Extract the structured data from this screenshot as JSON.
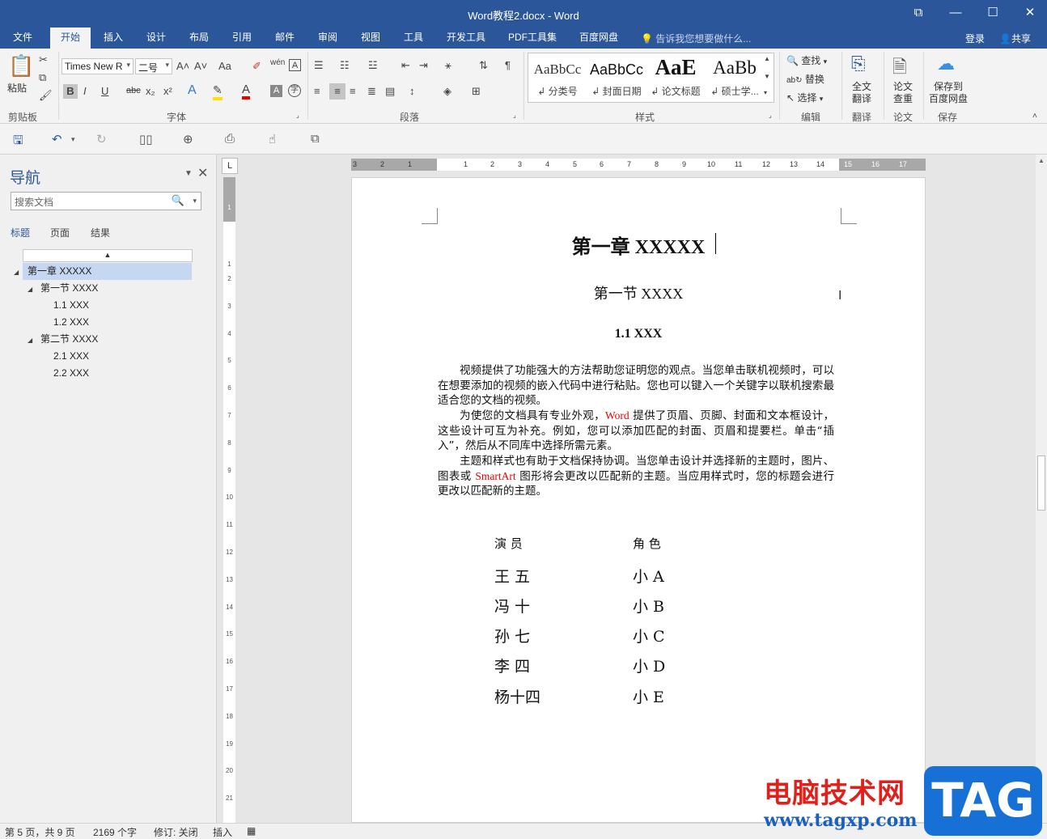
{
  "window": {
    "title": "Word教程2.docx - Word",
    "buttons": [
      "⧉",
      "—",
      "☐",
      "✕"
    ]
  },
  "tabs": [
    "文件",
    "开始",
    "插入",
    "设计",
    "布局",
    "引用",
    "邮件",
    "审阅",
    "视图",
    "工具",
    "开发工具",
    "PDF工具集",
    "百度网盘"
  ],
  "tell_me": "告诉我您想要做什么...",
  "login": "登录",
  "share": "共享",
  "ribbon": {
    "clipboard": {
      "paste": "粘贴",
      "label": "剪贴板"
    },
    "font": {
      "name": "Times New R",
      "size": "二号",
      "label": "字体",
      "aa": "Aa",
      "bold": "B",
      "italic": "I",
      "underline": "U",
      "strike": "abc",
      "sub": "x₂",
      "sup": "x²",
      "color_a": "A"
    },
    "paragraph": {
      "label": "段落"
    },
    "styles": {
      "label": "样式",
      "items": [
        {
          "sample": "AaBbCc",
          "name": "↲ 分类号"
        },
        {
          "sample": "AaBbCc",
          "name": "↲ 封面日期"
        },
        {
          "sample": "AaE",
          "name": "↲ 论文标题"
        },
        {
          "sample": "AaBb",
          "name": "↲ 硕士学..."
        }
      ]
    },
    "editing": {
      "find": "查找",
      "replace": "替换",
      "select": "选择",
      "label": "编辑"
    },
    "translate": {
      "btn1": "全文",
      "btn2": "翻译",
      "label": "翻译"
    },
    "thesis": {
      "btn1": "论文",
      "btn2": "查重",
      "label": "论文"
    },
    "save": {
      "btn1": "保存到",
      "btn2": "百度网盘",
      "label": "保存"
    }
  },
  "nav": {
    "title": "导航",
    "search_placeholder": "搜索文档",
    "tabs": [
      "标题",
      "页面",
      "结果"
    ],
    "collapse_glyph": "▲",
    "headings": [
      "第一章 XXXXX",
      "第一节 XXXX",
      "1.1 XXX",
      "1.2 XXX",
      "第二节 XXXX",
      "2.1 XXX",
      "2.2 XXX"
    ]
  },
  "ruler": {
    "h_labels": [
      "3",
      "2",
      "1",
      "1",
      "2",
      "3",
      "4",
      "5",
      "6",
      "7",
      "8",
      "9",
      "10",
      "11",
      "12",
      "13",
      "14",
      "15",
      "16",
      "17"
    ],
    "v_labels": [
      "1",
      "1",
      "2",
      "3",
      "4",
      "5",
      "6",
      "7",
      "8",
      "9",
      "10",
      "11",
      "12",
      "13",
      "14",
      "15",
      "16",
      "17",
      "18",
      "19",
      "20",
      "21"
    ],
    "corner": "L"
  },
  "document": {
    "h1": "第一章  XXXXX",
    "h2": "第一节  XXXX",
    "h3": "1.1 XXX",
    "p1": "视频提供了功能强大的方法帮助您证明您的观点。当您单击联机视频时，可以在想要添加的视频的嵌入代码中进行粘贴。您也可以键入一个关键字以联机搜索最适合您的文档的视频。",
    "p2a": "为使您的文档具有专业外观，",
    "p2_word": "Word",
    "p2b": " 提供了页眉、页脚、封面和文本框设计，这些设计可互为补充。例如，您可以添加匹配的封面、页眉和提要栏。单击“插入”，然后从不同库中选择所需元素。",
    "p3a": "主题和样式也有助于文档保持协调。当您单击设计并选择新的主题时，图片、图表或 ",
    "p3_smartart": "SmartArt",
    "p3b": " 图形将会更改以匹配新的主题。当应用样式时，您的标题会进行更改以匹配新的主题。",
    "cast_header": [
      "演      员",
      "角  色"
    ],
    "cast": [
      [
        "王    五",
        "小  A"
      ],
      [
        "冯    十",
        "小  B"
      ],
      [
        "孙    七",
        "小  C"
      ],
      [
        "李    四",
        "小  D"
      ],
      [
        "杨十四",
        "小  E"
      ]
    ]
  },
  "status": {
    "page": "第 5 页，共 9 页",
    "words": "2169 个字",
    "track": "修订: 关闭",
    "insert": "插入"
  },
  "watermark": {
    "text": "电脑技术网",
    "url": "www.tagxp.com",
    "tag": "TAG"
  }
}
